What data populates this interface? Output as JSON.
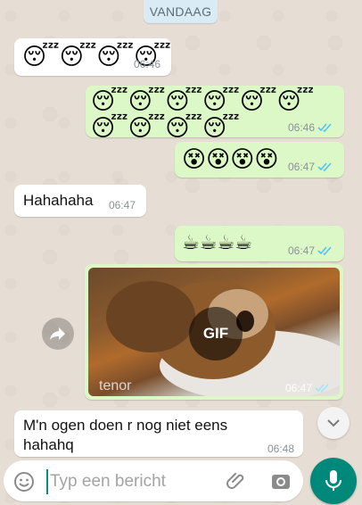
{
  "date_chip": "VANDAAG",
  "messages": [
    {
      "direction": "in",
      "emoji": "😴😴😴😴",
      "time": "06:46"
    },
    {
      "direction": "out",
      "emoji": "😴😴😴😴😴😴😴😴😴😴",
      "time": "06:46"
    },
    {
      "direction": "out",
      "emoji": "😵😵😵😵",
      "time": "06:47"
    },
    {
      "direction": "in",
      "text": "Hahahaha",
      "time": "06:47"
    },
    {
      "direction": "out",
      "emoji": "☕☕☕☕",
      "time": "06:47"
    },
    {
      "direction": "out",
      "type": "gif",
      "badge": "GIF",
      "provider": "tenor",
      "time": "06:47"
    },
    {
      "direction": "in",
      "text": "M'n ogen doen r nog niet eens hahahq",
      "time": "06:48"
    }
  ],
  "composer": {
    "placeholder": "Typ een bericht",
    "value": ""
  },
  "icons": {
    "emoji": "emoji-icon",
    "attach": "paperclip-icon",
    "camera": "camera-icon",
    "mic": "microphone-icon",
    "forward": "forward-icon",
    "scroll": "chevron-down-icon",
    "read": "double-check-icon"
  },
  "colors": {
    "incoming": "#ffffff",
    "outgoing": "#dcf8c6",
    "accent": "#00897b",
    "read_ticks": "#4fc3f7"
  }
}
